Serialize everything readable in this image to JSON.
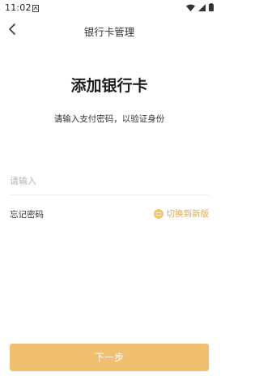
{
  "status_bar": {
    "time": "11:02"
  },
  "nav": {
    "title": "银行卡管理"
  },
  "main": {
    "headline": "添加银行卡",
    "subtitle": "请输入支付密码，以验证身份",
    "password_placeholder": "请输入",
    "forgot_password": "忘记密码",
    "switch_version": "切换到新版",
    "next_button": "下一步"
  },
  "colors": {
    "accent": "#f0c070",
    "accent_text": "#e2a84a",
    "background": "#ffffff"
  },
  "icons": {
    "back": "chevron-left-icon",
    "switch": "switch-icon",
    "wifi": "wifi-icon",
    "signal": "signal-icon",
    "battery": "battery-icon"
  }
}
